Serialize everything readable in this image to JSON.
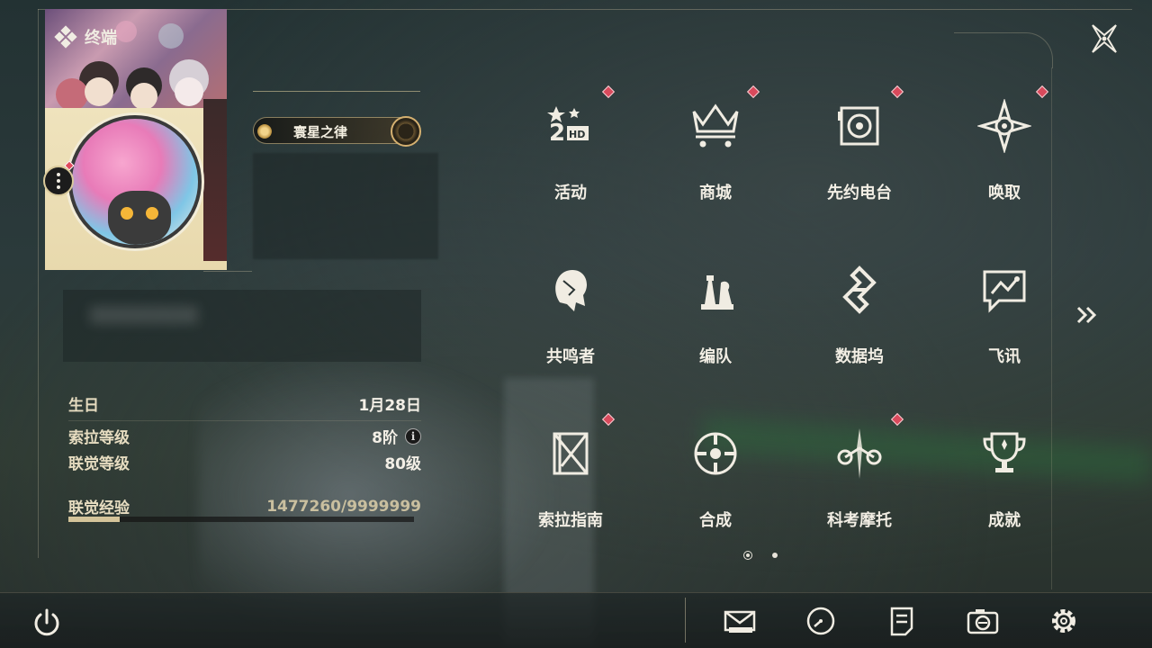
{
  "header": {
    "title": "终端"
  },
  "profile": {
    "title_badge": "寰星之律",
    "stats": [
      {
        "label": "生日",
        "value": "1月28日"
      },
      {
        "label": "索拉等级",
        "value": "8阶"
      },
      {
        "label": "联觉等级",
        "value": "80级"
      }
    ],
    "exp": {
      "label": "联觉经验",
      "value": "1477260/9999999",
      "progress": 0.148
    }
  },
  "menu": {
    "items": [
      {
        "label": "活动",
        "icon": "activity-2hd-icon",
        "badge": true
      },
      {
        "label": "商城",
        "icon": "shop-crown-icon",
        "badge": true
      },
      {
        "label": "先约电台",
        "icon": "radio-icon",
        "badge": true
      },
      {
        "label": "唤取",
        "icon": "gacha-star-icon",
        "badge": true
      },
      {
        "label": "共鸣者",
        "icon": "resonator-head-icon",
        "badge": false
      },
      {
        "label": "编队",
        "icon": "chess-team-icon",
        "badge": false
      },
      {
        "label": "数据坞",
        "icon": "data-dock-icon",
        "badge": false
      },
      {
        "label": "飞讯",
        "icon": "message-chat-icon",
        "badge": false
      },
      {
        "label": "索拉指南",
        "icon": "guide-book-icon",
        "badge": true
      },
      {
        "label": "合成",
        "icon": "synthesis-icon",
        "badge": false
      },
      {
        "label": "科考摩托",
        "icon": "motorcycle-icon",
        "badge": true
      },
      {
        "label": "成就",
        "icon": "trophy-icon",
        "badge": false
      }
    ]
  },
  "pagination": {
    "current": 1,
    "total": 2
  },
  "bottom_bar": {
    "icons": [
      "mail-icon",
      "clock-icon",
      "notice-icon",
      "camera-icon",
      "gear-icon"
    ]
  },
  "colors": {
    "accent": "#d4c49a",
    "badge": "#d94a5c",
    "text": "#f2eee4"
  }
}
